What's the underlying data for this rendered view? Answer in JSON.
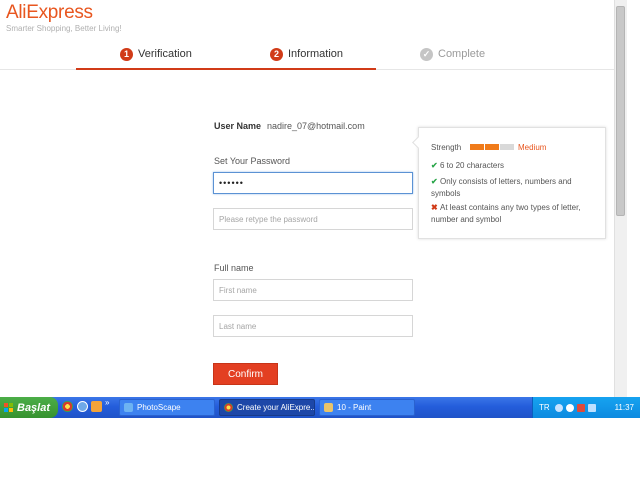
{
  "header": {
    "logo": "AliExpress",
    "tagline": "Smarter Shopping, Better Living!"
  },
  "steps": [
    {
      "number": "1",
      "label": "Verification",
      "state": "done"
    },
    {
      "number": "2",
      "label": "Information",
      "state": "current"
    },
    {
      "number": "✓",
      "label": "Complete",
      "state": "pending"
    }
  ],
  "form": {
    "username_label": "User Name",
    "username_value": "nadire_07@hotmail.com",
    "password_label": "Set Your Password",
    "password_value": "••••••",
    "retype_placeholder": "Please retype the password",
    "fullname_label": "Full name",
    "firstname_placeholder": "First name",
    "lastname_placeholder": "Last name",
    "confirm_label": "Confirm"
  },
  "strength": {
    "label": "Strength",
    "value": "Medium",
    "level": 0.67,
    "rules": [
      {
        "status": "ok",
        "text": "6 to 20 characters"
      },
      {
        "status": "ok",
        "text": "Only consists of letters, numbers and symbols"
      },
      {
        "status": "fail",
        "text": "At least contains any two types of letter, number and symbol"
      }
    ]
  },
  "taskbar": {
    "start_label": "Başlat",
    "chevron": "»",
    "tasks": [
      {
        "label": "PhotoScape"
      },
      {
        "label": "Create your AliExpre..."
      },
      {
        "label": "10 - Paint"
      }
    ],
    "language": "TR",
    "clock": "11:37"
  },
  "colors": {
    "brand": "#e8561f",
    "accent_red": "#d13b18",
    "button": "#e33f22",
    "ok_green": "#2aa64a",
    "taskbar_blue": "#245ddb",
    "start_green": "#36922f"
  }
}
